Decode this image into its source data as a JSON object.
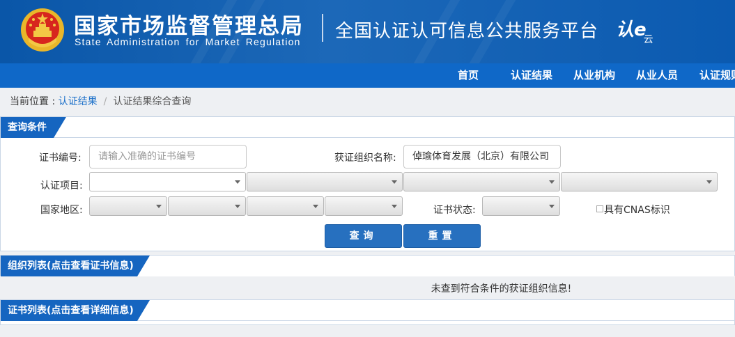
{
  "header": {
    "cn_title": "国家市场监督管理总局",
    "en_title": "State Administration for Market Regulation",
    "platform_title": "全国认证认可信息公共服务平台",
    "logo_text_a": "认e",
    "logo_text_b": "云"
  },
  "nav": {
    "items": [
      {
        "label": "首页"
      },
      {
        "label": "认证结果"
      },
      {
        "label": "从业机构"
      },
      {
        "label": "从业人员"
      },
      {
        "label": "认证规则"
      }
    ]
  },
  "breadcrumb": {
    "prefix": "当前位置 : ",
    "link": "认证结果",
    "separator": "/",
    "current": "认证结果综合查询"
  },
  "query_panel": {
    "title": "查询条件",
    "cert_no_label": "证书编号:",
    "cert_no_placeholder": "请输入准确的证书编号",
    "org_name_label": "获证组织名称:",
    "org_name_value": "倬瑜体育发展（北京）有限公司",
    "cert_item_label": "认证项目:",
    "region_label": "国家地区:",
    "cert_status_label": "证书状态:",
    "cnas_label": "具有CNAS标识",
    "search_button": "查询",
    "reset_button": "重置"
  },
  "org_panel": {
    "title": "组织列表(点击查看证书信息)",
    "empty_message": "未查到符合条件的获证组织信息!"
  },
  "cert_panel": {
    "title": "证书列表(点击查看详细信息)"
  },
  "colors": {
    "header_blue": "#0a56a8",
    "nav_blue": "#0f68c8",
    "accent_blue": "#1565c0",
    "button_blue": "#2770bf"
  }
}
